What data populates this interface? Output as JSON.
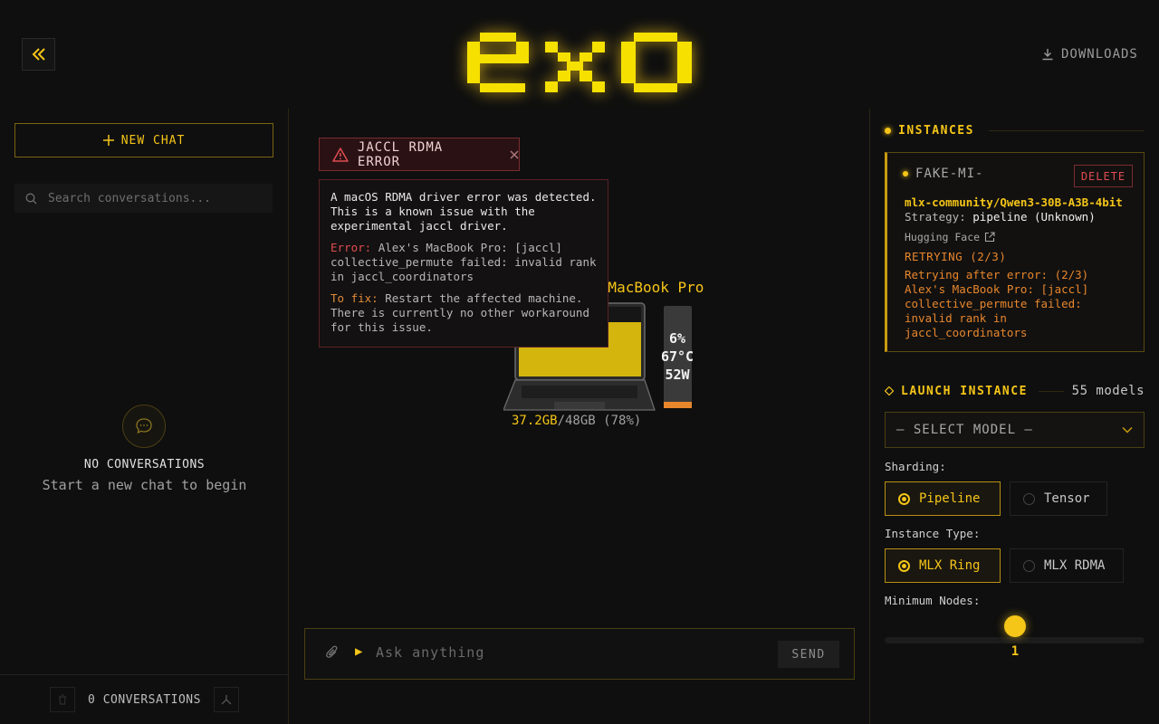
{
  "header": {
    "logo_text": "exo",
    "downloads_label": "DOWNLOADS"
  },
  "sidebar": {
    "new_chat_label": "NEW CHAT",
    "search_placeholder": "Search conversations...",
    "empty_title": "NO CONVERSATIONS",
    "empty_subtitle": "Start a new chat to begin",
    "conversation_count_label": "0 CONVERSATIONS"
  },
  "error": {
    "badge_label": "JACCL RDMA ERROR",
    "message": "A macOS RDMA driver error was detected. This is a known issue with the experimental jaccl driver.",
    "error_label": "Error:",
    "error_text": "Alex's MacBook Pro: [jaccl] collective_permute failed: invalid rank in jaccl_coordinators",
    "fix_label": "To fix:",
    "fix_text": "Restart the affected machine. There is currently no other workaround for this issue."
  },
  "device": {
    "name": "Alex's MacBook Pro",
    "gpu": "6%",
    "temp": "67°C",
    "power": "52W",
    "mem_used": "37.2GB",
    "mem_total": "/48GB",
    "mem_pct": "(78%)",
    "mem_fraction": 0.78,
    "gpu_fraction": 0.06
  },
  "chat": {
    "prompt_symbol": "▶",
    "placeholder": "Ask anything",
    "send_label": "SEND"
  },
  "instances": {
    "title": "INSTANCES",
    "card": {
      "name": "FAKE-MI-",
      "delete_label": "DELETE",
      "model": "mlx-community/Qwen3-30B-A3B-4bit",
      "strategy_label": "Strategy:",
      "strategy_value": "pipeline (Unknown)",
      "hf_label": "Hugging Face",
      "status": "RETRYING (2/3)",
      "error": "Retrying after error: (2/3) Alex's MacBook Pro: [jaccl] collective_permute failed: invalid rank in jaccl_coordinators"
    }
  },
  "launch": {
    "title": "LAUNCH INSTANCE",
    "model_count": "55 models",
    "select_label": "— SELECT MODEL —",
    "sharding_label": "Sharding:",
    "sharding_options": [
      "Pipeline",
      "Tensor"
    ],
    "instance_type_label": "Instance Type:",
    "instance_type_options": [
      "MLX Ring",
      "MLX RDMA"
    ],
    "min_nodes_label": "Minimum Nodes:",
    "min_nodes_value": "1"
  },
  "colors": {
    "accent": "#f5c518",
    "error": "#e04c50",
    "warning": "#e8862c",
    "background": "#0f0f0f"
  }
}
